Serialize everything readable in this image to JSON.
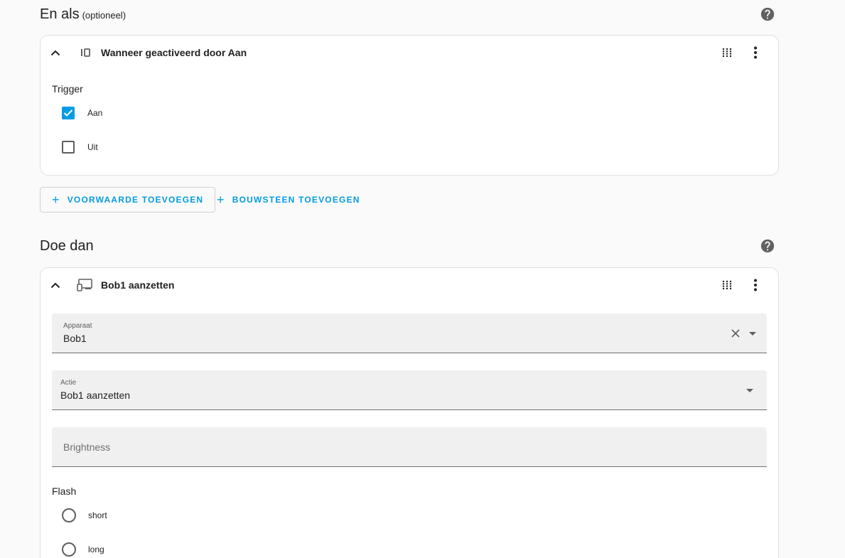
{
  "and_if": {
    "title": "En als",
    "optional": "(optioneel)",
    "help_icon": "help-circle-icon",
    "card": {
      "title": "Wanneer geactiveerd door Aan",
      "trigger_label": "Trigger",
      "options": [
        {
          "label": "Aan",
          "checked": true
        },
        {
          "label": "Uit",
          "checked": false
        }
      ]
    },
    "add_condition": "VOORWAARDE TOEVOEGEN",
    "add_building_block": "BOUWSTEEN TOEVOEGEN"
  },
  "then_do": {
    "title": "Doe dan",
    "help_icon": "help-circle-icon",
    "card": {
      "title": "Bob1 aanzetten",
      "device_field": {
        "label": "Apparaat",
        "value": "Bob1"
      },
      "action_field": {
        "label": "Actie",
        "value": "Bob1 aanzetten"
      },
      "brightness_field": {
        "placeholder": "Brightness"
      },
      "flash_label": "Flash",
      "flash_options": [
        "short",
        "long"
      ]
    }
  },
  "colors": {
    "accent": "#039be5",
    "card_bg": "#ffffff",
    "page_bg": "#fafafa"
  }
}
